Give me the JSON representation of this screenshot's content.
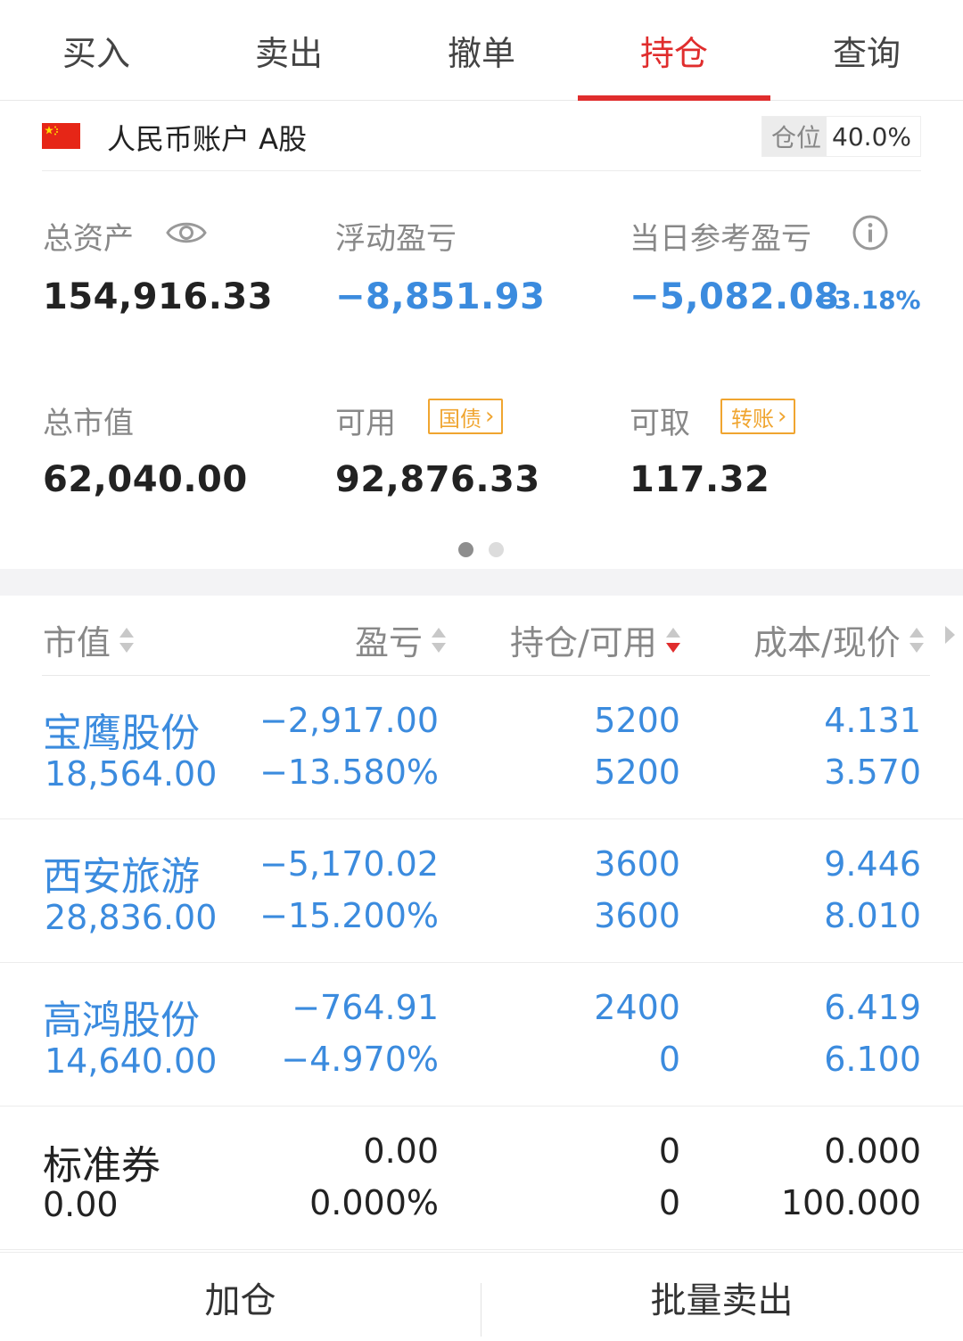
{
  "tabs": [
    {
      "label": "买入",
      "active": false
    },
    {
      "label": "卖出",
      "active": false
    },
    {
      "label": "撤单",
      "active": false
    },
    {
      "label": "持仓",
      "active": true
    },
    {
      "label": "查询",
      "active": false
    }
  ],
  "account": {
    "flag_icon": "china-flag-icon",
    "name": "人民币账户 A股",
    "position_label": "仓位",
    "position_value": "40.0%"
  },
  "summary": {
    "total_assets": {
      "label": "总资产",
      "value": "154,916.33",
      "icon": "eye-icon"
    },
    "floating_pl": {
      "label": "浮动盈亏",
      "value": "−8,851.93"
    },
    "daily_pl": {
      "label": "当日参考盈亏",
      "value": "−5,082.08",
      "percent": "−3.18%",
      "icon": "info-icon"
    },
    "market_value": {
      "label": "总市值",
      "value": "62,040.00"
    },
    "available": {
      "label": "可用",
      "value": "92,876.33",
      "tag": "国债"
    },
    "withdrawable": {
      "label": "可取",
      "value": "117.32",
      "tag": "转账"
    }
  },
  "pager": {
    "pages": 2,
    "current": 1
  },
  "table": {
    "headers": [
      "市值",
      "盈亏",
      "持仓/可用",
      "成本/现价"
    ],
    "rows": [
      {
        "name": "宝鹰股份",
        "market_value": "18,564.00",
        "pl": "−2,917.00",
        "pl_pct": "−13.580%",
        "position": "5200",
        "available": "5200",
        "cost": "4.131",
        "price": "3.570"
      },
      {
        "name": "西安旅游",
        "market_value": "28,836.00",
        "pl": "−5,170.02",
        "pl_pct": "−15.200%",
        "position": "3600",
        "available": "3600",
        "cost": "9.446",
        "price": "8.010"
      },
      {
        "name": "高鸿股份",
        "market_value": "14,640.00",
        "pl": "−764.91",
        "pl_pct": "−4.970%",
        "position": "2400",
        "available": "0",
        "cost": "6.419",
        "price": "6.100"
      },
      {
        "name": "标准券",
        "market_value": "0.00",
        "pl": "0.00",
        "pl_pct": "0.000%",
        "position": "0",
        "available": "0",
        "cost": "0.000",
        "price": "100.000"
      }
    ]
  },
  "actions": {
    "add": "加仓",
    "batch_sell": "批量卖出"
  },
  "colors": {
    "accent": "#e02d2d",
    "negative": "#3b8bde",
    "tag": "#f0a530"
  }
}
